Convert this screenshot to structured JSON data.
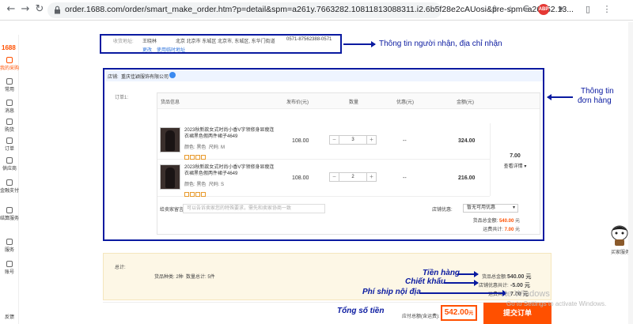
{
  "browser": {
    "url": "order.1688.com/order/smart_make_order.htm?p=detail&spm=a261y.7663282.10811813088311.i2.6b5f28e2cAUosi&pre-spm=a26352.13...",
    "extensions": [
      "share-icon",
      "star-icon",
      "google-icon",
      "abp-icon",
      "puzzle-icon",
      "sidepanel-icon",
      "menu-icon"
    ],
    "abp_label": "ABP"
  },
  "sidebar": {
    "logo": "1688",
    "items": [
      {
        "label": "我的采购",
        "icon": "home-icon",
        "active": true
      },
      {
        "label": "常用",
        "icon": "star-icon"
      },
      {
        "label": "消息",
        "icon": "message-icon"
      },
      {
        "label": "购货",
        "icon": "cart-icon"
      },
      {
        "label": "订单",
        "icon": "order-icon"
      },
      {
        "label": "供应商",
        "icon": "supplier-icon"
      },
      {
        "label": "金融支付",
        "icon": "finance-icon"
      },
      {
        "label": "结算服务",
        "icon": "settle-icon"
      },
      {
        "label": "服务",
        "icon": "service-icon"
      },
      {
        "label": "账号",
        "icon": "account-icon"
      },
      {
        "label": "反馈",
        "icon": "feedback-icon"
      }
    ]
  },
  "address": {
    "label": "收货地址:",
    "name": "王晓林",
    "region": "北京 北京市 东城区 北京市, 东城区, 东华门街道",
    "phone": "0571-87562388-0571",
    "change_link": "更改",
    "temp_link": "使用临时地址"
  },
  "shop": {
    "label": "店铺:",
    "name": "重庆佳颖服饰有限公司"
  },
  "order": {
    "label": "订单1:",
    "headers": [
      "货品信息",
      "发布价(元)",
      "数量",
      "优惠(元)",
      "金额(元)"
    ],
    "items": [
      {
        "title": "2023秋新款女式时尚小香V字领修身显瘦连衣裙黑色假两件裙子4649",
        "color_label": "颜色:",
        "color": "黑色",
        "size_label": "尺码:",
        "size": "M",
        "price": "108.00",
        "qty": "3",
        "discount": "--",
        "amount": "324.00"
      },
      {
        "title": "2023秋新款女式时尚小香V字领修身显瘦连衣裙黑色假两件裙子4649",
        "color_label": "颜色:",
        "color": "黑色",
        "size_label": "尺码:",
        "size": "S",
        "price": "108.00",
        "qty": "2",
        "discount": "--",
        "amount": "216.00"
      }
    ],
    "shipping_value": "7.00",
    "shipping_detail": "查看详情",
    "message_label": "给卖家留言:",
    "message_placeholder": "可以告诉卖家您的特殊要求，需先和卖家协商一致",
    "coupon_label": "店铺优惠:",
    "coupon_value": "暂无可用优惠",
    "goods_total_label": "货品总金额:",
    "goods_total": "540.00",
    "goods_total_unit": "元",
    "ship_total_label": "运费共计:",
    "ship_total": "7.00",
    "ship_total_unit": "元"
  },
  "summary": {
    "total_label": "总计:",
    "kinds": "货品种类: 2种",
    "count": "数量总计: 5件",
    "goods_total_label": "货品总金额:",
    "goods_total": "540.00 元",
    "discount_label": "店铺优惠共计:",
    "discount": "-5.00 元",
    "ship_label": "运费共计:",
    "ship": "7.00 元",
    "pay_label": "应付总额(含运费):",
    "pay_total": "542.00",
    "pay_unit": "元",
    "submit": "提交订单"
  },
  "annotations": {
    "receiver": "Thông tin người nhận, địa chỉ nhận",
    "order_info_line1": "Thông tin",
    "order_info_line2": "đơn hàng",
    "goods_money": "Tiền hàng",
    "discount": "Chiết khấu",
    "ship_fee": "Phí ship nội địa",
    "total": "Tổng số tiền"
  },
  "watermark": {
    "line1": "te Windows",
    "line2": "Go to Settings to activate Windows."
  },
  "mascot_label": "买家服务",
  "colors": {
    "accent": "#ff5000",
    "annotation": "#0a1aa0",
    "total_bg": "#fdf7e6"
  }
}
